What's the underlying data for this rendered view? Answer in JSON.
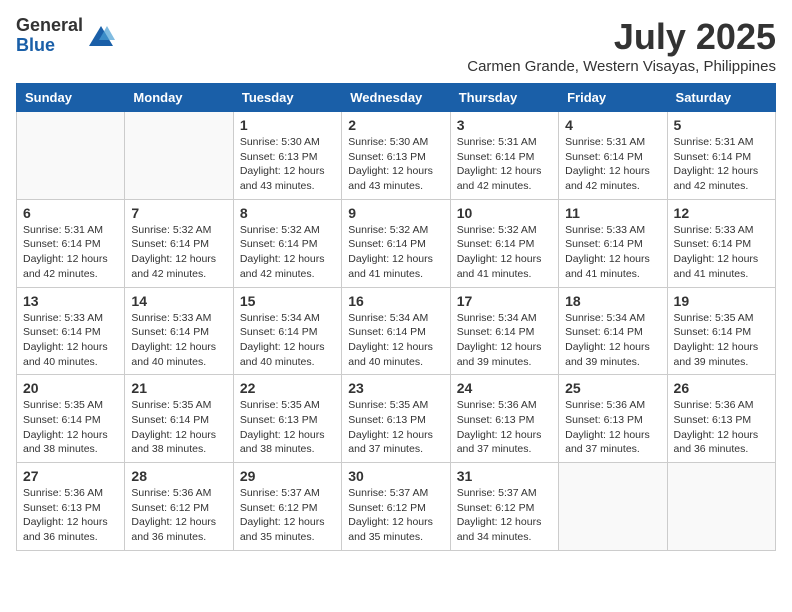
{
  "logo": {
    "general": "General",
    "blue": "Blue"
  },
  "title": "July 2025",
  "location": "Carmen Grande, Western Visayas, Philippines",
  "days_of_week": [
    "Sunday",
    "Monday",
    "Tuesday",
    "Wednesday",
    "Thursday",
    "Friday",
    "Saturday"
  ],
  "weeks": [
    [
      {
        "day": "",
        "info": ""
      },
      {
        "day": "",
        "info": ""
      },
      {
        "day": "1",
        "info": "Sunrise: 5:30 AM\nSunset: 6:13 PM\nDaylight: 12 hours and 43 minutes."
      },
      {
        "day": "2",
        "info": "Sunrise: 5:30 AM\nSunset: 6:13 PM\nDaylight: 12 hours and 43 minutes."
      },
      {
        "day": "3",
        "info": "Sunrise: 5:31 AM\nSunset: 6:14 PM\nDaylight: 12 hours and 42 minutes."
      },
      {
        "day": "4",
        "info": "Sunrise: 5:31 AM\nSunset: 6:14 PM\nDaylight: 12 hours and 42 minutes."
      },
      {
        "day": "5",
        "info": "Sunrise: 5:31 AM\nSunset: 6:14 PM\nDaylight: 12 hours and 42 minutes."
      }
    ],
    [
      {
        "day": "6",
        "info": "Sunrise: 5:31 AM\nSunset: 6:14 PM\nDaylight: 12 hours and 42 minutes."
      },
      {
        "day": "7",
        "info": "Sunrise: 5:32 AM\nSunset: 6:14 PM\nDaylight: 12 hours and 42 minutes."
      },
      {
        "day": "8",
        "info": "Sunrise: 5:32 AM\nSunset: 6:14 PM\nDaylight: 12 hours and 42 minutes."
      },
      {
        "day": "9",
        "info": "Sunrise: 5:32 AM\nSunset: 6:14 PM\nDaylight: 12 hours and 41 minutes."
      },
      {
        "day": "10",
        "info": "Sunrise: 5:32 AM\nSunset: 6:14 PM\nDaylight: 12 hours and 41 minutes."
      },
      {
        "day": "11",
        "info": "Sunrise: 5:33 AM\nSunset: 6:14 PM\nDaylight: 12 hours and 41 minutes."
      },
      {
        "day": "12",
        "info": "Sunrise: 5:33 AM\nSunset: 6:14 PM\nDaylight: 12 hours and 41 minutes."
      }
    ],
    [
      {
        "day": "13",
        "info": "Sunrise: 5:33 AM\nSunset: 6:14 PM\nDaylight: 12 hours and 40 minutes."
      },
      {
        "day": "14",
        "info": "Sunrise: 5:33 AM\nSunset: 6:14 PM\nDaylight: 12 hours and 40 minutes."
      },
      {
        "day": "15",
        "info": "Sunrise: 5:34 AM\nSunset: 6:14 PM\nDaylight: 12 hours and 40 minutes."
      },
      {
        "day": "16",
        "info": "Sunrise: 5:34 AM\nSunset: 6:14 PM\nDaylight: 12 hours and 40 minutes."
      },
      {
        "day": "17",
        "info": "Sunrise: 5:34 AM\nSunset: 6:14 PM\nDaylight: 12 hours and 39 minutes."
      },
      {
        "day": "18",
        "info": "Sunrise: 5:34 AM\nSunset: 6:14 PM\nDaylight: 12 hours and 39 minutes."
      },
      {
        "day": "19",
        "info": "Sunrise: 5:35 AM\nSunset: 6:14 PM\nDaylight: 12 hours and 39 minutes."
      }
    ],
    [
      {
        "day": "20",
        "info": "Sunrise: 5:35 AM\nSunset: 6:14 PM\nDaylight: 12 hours and 38 minutes."
      },
      {
        "day": "21",
        "info": "Sunrise: 5:35 AM\nSunset: 6:14 PM\nDaylight: 12 hours and 38 minutes."
      },
      {
        "day": "22",
        "info": "Sunrise: 5:35 AM\nSunset: 6:13 PM\nDaylight: 12 hours and 38 minutes."
      },
      {
        "day": "23",
        "info": "Sunrise: 5:35 AM\nSunset: 6:13 PM\nDaylight: 12 hours and 37 minutes."
      },
      {
        "day": "24",
        "info": "Sunrise: 5:36 AM\nSunset: 6:13 PM\nDaylight: 12 hours and 37 minutes."
      },
      {
        "day": "25",
        "info": "Sunrise: 5:36 AM\nSunset: 6:13 PM\nDaylight: 12 hours and 37 minutes."
      },
      {
        "day": "26",
        "info": "Sunrise: 5:36 AM\nSunset: 6:13 PM\nDaylight: 12 hours and 36 minutes."
      }
    ],
    [
      {
        "day": "27",
        "info": "Sunrise: 5:36 AM\nSunset: 6:13 PM\nDaylight: 12 hours and 36 minutes."
      },
      {
        "day": "28",
        "info": "Sunrise: 5:36 AM\nSunset: 6:12 PM\nDaylight: 12 hours and 36 minutes."
      },
      {
        "day": "29",
        "info": "Sunrise: 5:37 AM\nSunset: 6:12 PM\nDaylight: 12 hours and 35 minutes."
      },
      {
        "day": "30",
        "info": "Sunrise: 5:37 AM\nSunset: 6:12 PM\nDaylight: 12 hours and 35 minutes."
      },
      {
        "day": "31",
        "info": "Sunrise: 5:37 AM\nSunset: 6:12 PM\nDaylight: 12 hours and 34 minutes."
      },
      {
        "day": "",
        "info": ""
      },
      {
        "day": "",
        "info": ""
      }
    ]
  ]
}
